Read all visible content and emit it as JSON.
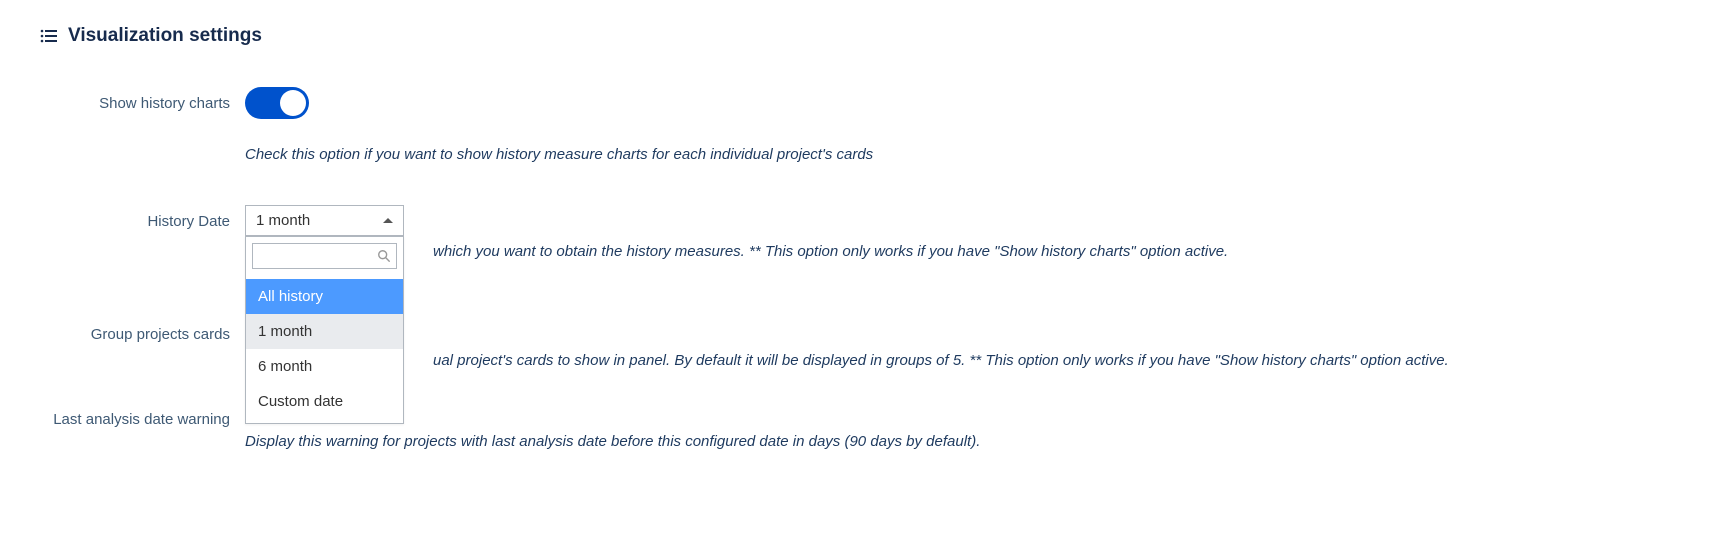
{
  "section": {
    "title": "Visualization settings"
  },
  "show_history": {
    "label": "Show history charts",
    "help": "Check this option if you want to show history measure charts for each individual project's cards",
    "enabled": true
  },
  "history_date": {
    "label": "History Date",
    "value": "1 month",
    "help_fragment": "which you want to obtain the history measures. ** This option only works if you have \"Show history charts\" option active.",
    "options": [
      "All history",
      "1 month",
      "6 month",
      "Custom date"
    ],
    "search_placeholder": ""
  },
  "group_projects": {
    "label": "Group projects cards",
    "help_fragment": "ual project's cards to show in panel. By default it will be displayed in groups of 5. ** This option only works if you have \"Show history charts\" option active."
  },
  "last_analysis": {
    "label": "Last analysis date warning",
    "help": "Display this warning for projects with last analysis date before this configured date in days (90 days by default)."
  }
}
